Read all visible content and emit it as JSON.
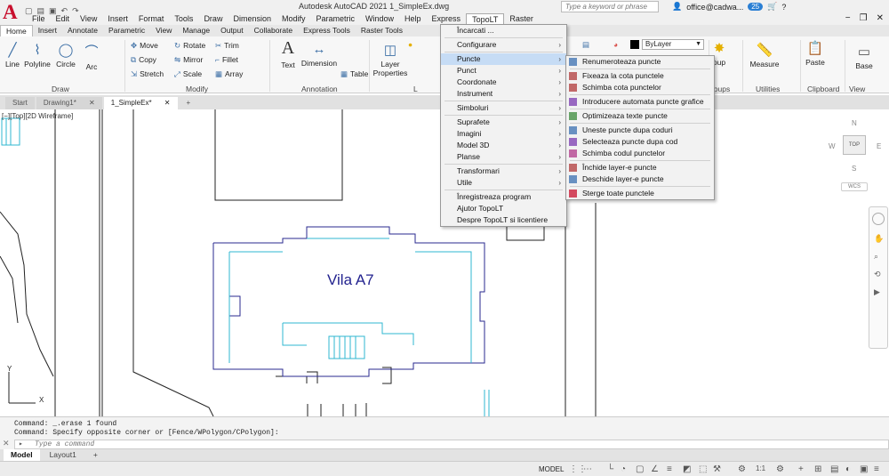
{
  "app_title": "Autodesk AutoCAD 2021    1_SimpleEx.dwg",
  "search_placeholder": "Type a keyword or phrase",
  "user": "office@cadwa...",
  "badge_count": "25",
  "menubar": [
    "File",
    "Edit",
    "View",
    "Insert",
    "Format",
    "Tools",
    "Draw",
    "Dimension",
    "Modify",
    "Parametric",
    "Window",
    "Help",
    "Express",
    "TopoLT",
    "Raster"
  ],
  "ribbon_tabs": [
    "Home",
    "Insert",
    "Annotate",
    "Parametric",
    "View",
    "Manage",
    "Output",
    "Collaborate",
    "Express Tools",
    "Raster Tools"
  ],
  "ribbon": {
    "draw": {
      "line": "Line",
      "polyline": "Polyline",
      "circle": "Circle",
      "arc": "Arc",
      "title": "Draw"
    },
    "modify": {
      "move": "Move",
      "rotate": "Rotate",
      "trim": "Trim",
      "copy": "Copy",
      "mirror": "Mirror",
      "fillet": "Fillet",
      "stretch": "Stretch",
      "scale": "Scale",
      "array": "Array",
      "title": "Modify"
    },
    "annotation": {
      "text": "Text",
      "dimension": "Dimension",
      "table": "Table",
      "title": "Annotation"
    },
    "layers": {
      "layer_properties": "Layer\nProperties",
      "title": "L"
    },
    "properties": {
      "bylayer": "ByLayer"
    },
    "groups": {
      "group": "oup",
      "title": "roups"
    },
    "utilities": {
      "measure": "Measure",
      "title": "Utilities"
    },
    "clipboard": {
      "paste": "Paste",
      "title": "Clipboard"
    },
    "view": {
      "base": "Base",
      "title": "View"
    }
  },
  "doc_tabs": [
    "Start",
    "Drawing1*",
    "1_SimpleEx*"
  ],
  "view_label": "[−][Top][2D Wireframe]",
  "drawing_label": "Vila A7",
  "topolt_menu": [
    {
      "label": "Încarcati ...",
      "arrow": false
    },
    {
      "sep": true
    },
    {
      "label": "Configurare",
      "arrow": true
    },
    {
      "sep": true
    },
    {
      "label": "Puncte",
      "arrow": true,
      "highlight": true
    },
    {
      "label": "Punct",
      "arrow": true
    },
    {
      "label": "Coordonate",
      "arrow": true
    },
    {
      "label": "Instrument",
      "arrow": true
    },
    {
      "sep": true
    },
    {
      "label": "Simboluri",
      "arrow": true
    },
    {
      "sep": true
    },
    {
      "label": "Suprafete",
      "arrow": true
    },
    {
      "label": "Imagini",
      "arrow": true
    },
    {
      "label": "Model 3D",
      "arrow": true
    },
    {
      "label": "Planse",
      "arrow": true
    },
    {
      "sep": true
    },
    {
      "label": "Transformari",
      "arrow": true
    },
    {
      "label": "Utile",
      "arrow": true
    },
    {
      "sep": true
    },
    {
      "label": "Înregistreaza program",
      "arrow": false
    },
    {
      "label": "Ajutor TopoLT",
      "arrow": false
    },
    {
      "label": "Despre TopoLT si licentiere",
      "arrow": false
    }
  ],
  "puncte_submenu": [
    {
      "label": "Renumeroteaza puncte",
      "color": "#3a6fb0"
    },
    {
      "sep": true
    },
    {
      "label": "Fixeaza la cota punctele",
      "color": "#b03a3a"
    },
    {
      "label": "Schimba cota punctelor",
      "color": "#b03a3a"
    },
    {
      "sep": true
    },
    {
      "label": "Introducere automata puncte grafice",
      "color": "#7a3ab0"
    },
    {
      "sep": true
    },
    {
      "label": "Optimizeaza texte puncte",
      "color": "#3a8a3a"
    },
    {
      "sep": true
    },
    {
      "label": "Uneste puncte dupa coduri",
      "color": "#3a6fb0"
    },
    {
      "label": "Selecteaza puncte dupa cod",
      "color": "#7a3ab0"
    },
    {
      "label": "Schimba codul punctelor",
      "color": "#b03a8a"
    },
    {
      "sep": true
    },
    {
      "label": "Închide layer-e puncte",
      "color": "#b03a3a"
    },
    {
      "label": "Deschide layer-e puncte",
      "color": "#3a6fb0"
    },
    {
      "sep": true
    },
    {
      "label": "Sterge toate punctele",
      "color": "#c8102e"
    }
  ],
  "command_history": [
    "Command: _.erase 1 found",
    "Command: Specify opposite corner or [Fence/WPolygon/CPolygon]:"
  ],
  "command_placeholder": "Type a command",
  "layout_tabs": [
    "Model",
    "Layout1"
  ],
  "status_model": "MODEL",
  "viewcube": {
    "top": "TOP",
    "n": "N",
    "s": "S",
    "e": "E",
    "w": "W",
    "wcs": "WCS"
  }
}
